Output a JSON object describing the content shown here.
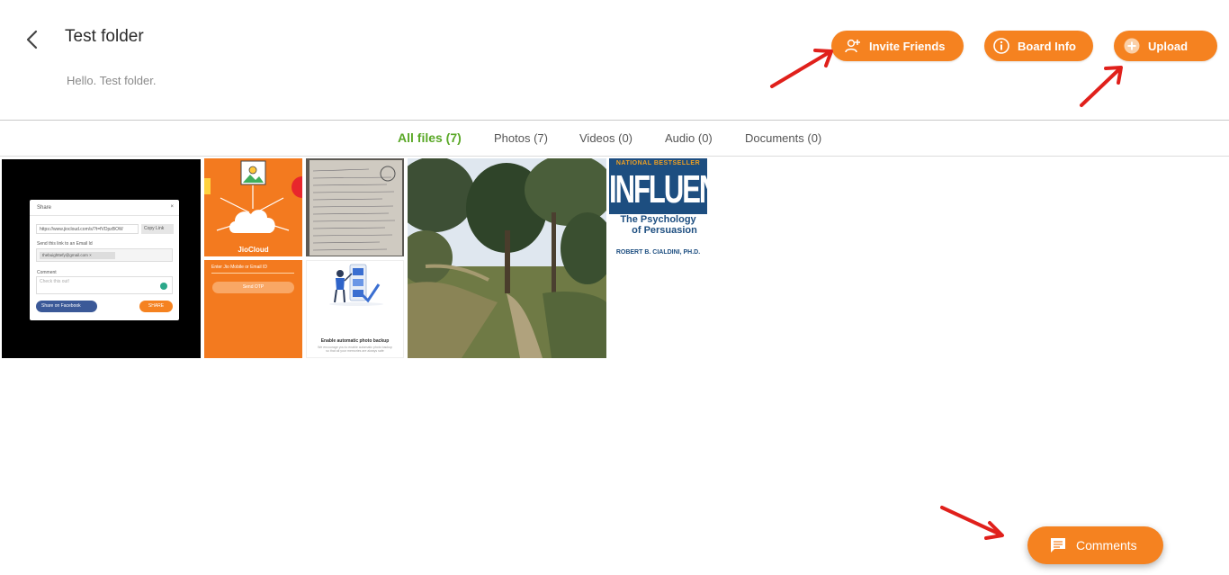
{
  "header": {
    "title": "Test folder",
    "subtitle": "Hello. Test folder.",
    "buttons": {
      "invite": "Invite Friends",
      "board_info": "Board Info",
      "upload": "Upload"
    }
  },
  "tabs": [
    {
      "label": "All files (7)",
      "active": true
    },
    {
      "label": "Photos (7)",
      "active": false
    },
    {
      "label": "Videos (0)",
      "active": false
    },
    {
      "label": "Audio (0)",
      "active": false
    },
    {
      "label": "Documents (0)",
      "active": false
    }
  ],
  "tiles": {
    "share_dialog": {
      "title": "Share",
      "close": "×",
      "link": "https://www.jiocloud.com/s/?t=fVDpzBOW",
      "copy_link": "Copy Link",
      "send_label": "Send this link to an Email Id",
      "email_chip": "thebuighttefy@gmail.com ×",
      "comment_label": "Comment",
      "comment_value": "Check this out!",
      "facebook": "Share on Facebook",
      "share": "SHARE"
    },
    "jiocloud": {
      "label": "JioCloud"
    },
    "otp": {
      "input": "Enter Jio Mobile or Email ID",
      "button": "Send OTP"
    },
    "backup": {
      "title": "Enable automatic photo backup",
      "subtitle": "We encourage you to enable automatic photo backup so that all your memories are always safe"
    },
    "book": {
      "top_line": "NATIONAL BESTSELLER",
      "title": "INFLUENCE",
      "subtitle_1": "The Psychology",
      "subtitle_2": "of Persuasion",
      "author": "ROBERT B. CIALDINI, PH.D."
    }
  },
  "comments": {
    "label": "Comments"
  },
  "colors": {
    "accent": "#f58220",
    "active_tab": "#5aa827",
    "annotation": "#e0201b"
  }
}
